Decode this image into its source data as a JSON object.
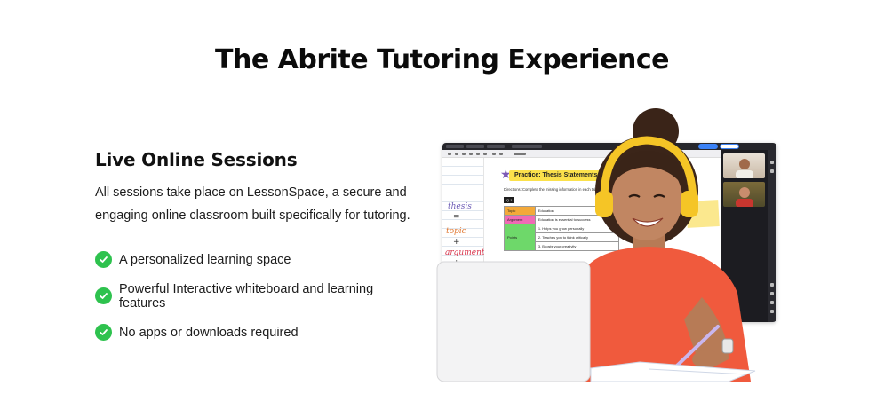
{
  "page": {
    "title": "The Abrite Tutoring Experience"
  },
  "section": {
    "heading": "Live Online Sessions",
    "description": "All sessions take place on LessonSpace, a secure and engaging online classroom built specifically for tutoring.",
    "features": [
      {
        "text": "A personalized learning space",
        "icon": "check-circle-icon"
      },
      {
        "text": "Powerful Interactive whiteboard and learning features",
        "icon": "check-circle-icon"
      },
      {
        "text": "No apps or downloads required",
        "icon": "check-circle-icon"
      }
    ]
  },
  "illustration": {
    "worksheet": {
      "title": "Practice: Thesis Statements",
      "directions": "Directions: Complete the missing information in each table to",
      "question": "Q.1",
      "rows": [
        {
          "label": "Topic",
          "value": "Education"
        },
        {
          "label": "Argument",
          "value": "Education is essential to success"
        },
        {
          "label": "Points",
          "value": "1. Helps you grow personally"
        },
        {
          "label": "",
          "value": "2. Teaches you to think critically"
        },
        {
          "label": "",
          "value": "3. Boosts your creativity"
        }
      ]
    },
    "notebook_words": [
      "thesis",
      "=",
      "topic",
      "+",
      "argument",
      "+"
    ],
    "colors": {
      "check": "#2ec24e",
      "highlight": "#fbe14b",
      "shirt": "#f05a3d",
      "headphones": "#f5c526"
    }
  }
}
